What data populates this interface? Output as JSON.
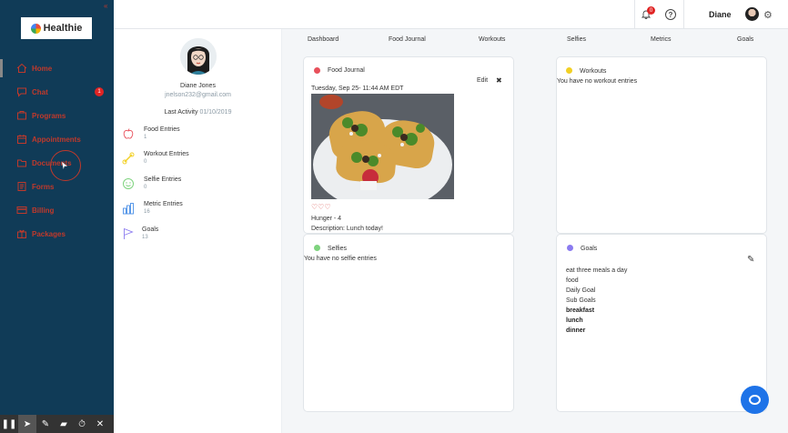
{
  "app": {
    "logo_text": "Healthie",
    "collapse_glyph": "«",
    "accent": "#c0392b"
  },
  "sidebar": {
    "items": [
      {
        "label": "Home",
        "icon": "home-icon"
      },
      {
        "label": "Chat",
        "icon": "chat-icon",
        "badge": "1"
      },
      {
        "label": "Programs",
        "icon": "programs-icon"
      },
      {
        "label": "Appointments",
        "icon": "calendar-icon"
      },
      {
        "label": "Documents",
        "icon": "folder-icon"
      },
      {
        "label": "Forms",
        "icon": "forms-icon"
      },
      {
        "label": "Billing",
        "icon": "credit-card-icon"
      },
      {
        "label": "Packages",
        "icon": "package-icon"
      }
    ]
  },
  "topbar": {
    "notification_count": "0",
    "help_glyph": "?",
    "user_name": "Diane",
    "settings_glyph": "⚙"
  },
  "profile": {
    "name": "Diane Jones",
    "email": "jnelson232@gmail.com",
    "last_activity_label": "Last Activity",
    "last_activity_date": "01/10/2019",
    "stats": [
      {
        "label": "Food Entries",
        "value": "1",
        "icon": "apple-icon"
      },
      {
        "label": "Workout Entries",
        "value": "0",
        "icon": "dumbbell-icon"
      },
      {
        "label": "Selfie Entries",
        "value": "0",
        "icon": "smiley-icon"
      },
      {
        "label": "Metric Entries",
        "value": "16",
        "icon": "bar-chart-icon"
      },
      {
        "label": "Goals",
        "value": "13",
        "icon": "flag-icon"
      }
    ]
  },
  "tabs": [
    "Dashboard",
    "Food Journal",
    "Workouts",
    "Selfies",
    "Metrics",
    "Goals"
  ],
  "cards": {
    "food_journal": {
      "title": "Food Journal",
      "edit": "Edit",
      "close": "✖",
      "timestamp": "Tuesday, Sep 25- 11:44 AM EDT",
      "hearts": "♡♡♡",
      "hunger": "Hunger - 4",
      "description": "Description: Lunch today!",
      "dot_color": "#e8505b"
    },
    "workouts": {
      "title": "Workouts",
      "empty": "You have no workout entries",
      "dot_color": "#f2d024"
    },
    "selfies": {
      "title": "Selfies",
      "empty": "You have no selfie entries",
      "dot_color": "#7ed37e"
    },
    "goals": {
      "title": "Goals",
      "dot_color": "#8b7bf0",
      "edit_glyph": "✎",
      "lines": [
        {
          "text": "eat three meals a day",
          "bold": false
        },
        {
          "text": "food",
          "bold": false
        },
        {
          "text": "Daily Goal",
          "bold": false
        },
        {
          "text": "Sub Goals",
          "bold": false
        },
        {
          "text": "breakfast",
          "bold": true
        },
        {
          "text": "lunch",
          "bold": true
        },
        {
          "text": "dinner",
          "bold": true
        }
      ]
    }
  },
  "recorder_toolbar": {
    "buttons": [
      {
        "glyph": "❚❚",
        "icon": "pause-icon"
      },
      {
        "glyph": "➤",
        "icon": "pointer-icon"
      },
      {
        "glyph": "✎",
        "icon": "pen-icon"
      },
      {
        "glyph": "▰",
        "icon": "eraser-icon"
      },
      {
        "glyph": "⏱",
        "icon": "timer-icon"
      },
      {
        "glyph": "✕",
        "icon": "close-icon"
      }
    ]
  }
}
